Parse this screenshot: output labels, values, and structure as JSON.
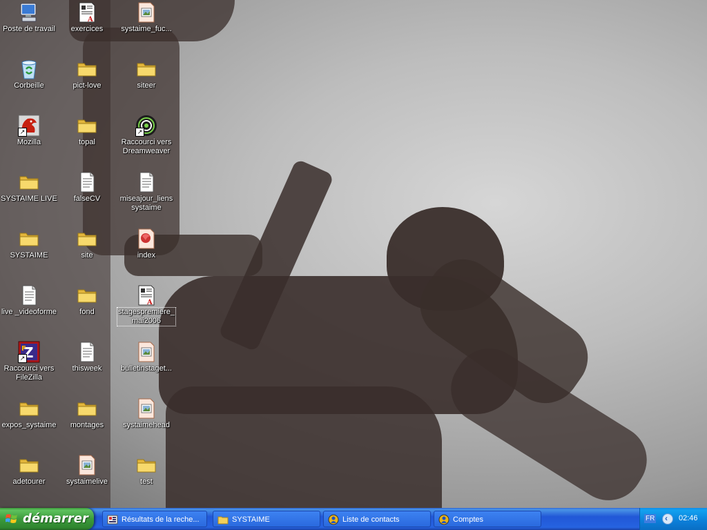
{
  "desktop": {
    "icons": [
      {
        "label": "Poste de travail",
        "icon": "computer-icon",
        "col": 0,
        "row": 0
      },
      {
        "label": "exercices",
        "icon": "document-icon",
        "col": 1,
        "row": 0
      },
      {
        "label": "systaime_fuc...",
        "icon": "image-file-icon",
        "col": 2,
        "row": 0
      },
      {
        "label": "Corbeille",
        "icon": "recycle-bin-icon",
        "col": 0,
        "row": 1
      },
      {
        "label": "pict-love",
        "icon": "folder-icon",
        "col": 1,
        "row": 1
      },
      {
        "label": "siteer",
        "icon": "folder-icon",
        "col": 2,
        "row": 1
      },
      {
        "label": "Mozilla",
        "icon": "mozilla-icon",
        "col": 0,
        "row": 2,
        "shortcut": true
      },
      {
        "label": "topal",
        "icon": "folder-icon",
        "col": 1,
        "row": 2
      },
      {
        "label": "Raccourci vers Dreamweaver",
        "icon": "dreamweaver-icon",
        "col": 2,
        "row": 2,
        "shortcut": true
      },
      {
        "label": "SYSTAIME LIVE",
        "icon": "folder-icon",
        "col": 0,
        "row": 3
      },
      {
        "label": "falseCV",
        "icon": "text-file-icon",
        "col": 1,
        "row": 3
      },
      {
        "label": "miseajour_liens systaime",
        "icon": "text-file-icon",
        "col": 2,
        "row": 3
      },
      {
        "label": "SYSTAIME",
        "icon": "folder-icon",
        "col": 0,
        "row": 4
      },
      {
        "label": "site",
        "icon": "folder-icon",
        "col": 1,
        "row": 4
      },
      {
        "label": "index",
        "icon": "html-file-icon",
        "col": 2,
        "row": 4
      },
      {
        "label": "live _videoforme",
        "icon": "text-file-icon",
        "col": 0,
        "row": 5
      },
      {
        "label": "fond",
        "icon": "folder-icon",
        "col": 1,
        "row": 5
      },
      {
        "label": "stagespremiere_ mai2006",
        "icon": "document-icon",
        "col": 2,
        "row": 5,
        "selected": true
      },
      {
        "label": "Raccourci vers FileZilla",
        "icon": "filezilla-icon",
        "col": 0,
        "row": 6,
        "shortcut": true
      },
      {
        "label": "thisweek",
        "icon": "text-file-icon",
        "col": 1,
        "row": 6
      },
      {
        "label": "bulletinstaget...",
        "icon": "image-file-icon",
        "col": 2,
        "row": 6
      },
      {
        "label": "expos_systaime",
        "icon": "folder-icon",
        "col": 0,
        "row": 7
      },
      {
        "label": "montages",
        "icon": "folder-icon",
        "col": 1,
        "row": 7
      },
      {
        "label": "systaimehead",
        "icon": "image-file-icon",
        "col": 2,
        "row": 7
      },
      {
        "label": "adetourer",
        "icon": "folder-icon",
        "col": 0,
        "row": 8
      },
      {
        "label": "systaimelive",
        "icon": "image-file-icon",
        "col": 1,
        "row": 8
      },
      {
        "label": "test",
        "icon": "folder-icon",
        "col": 2,
        "row": 8
      }
    ]
  },
  "taskbar": {
    "start_label": "démarrer",
    "tasks": [
      {
        "label": "Résultats de la reche...",
        "icon": "search-results-icon"
      },
      {
        "label": "SYSTAIME",
        "icon": "folder-icon"
      },
      {
        "label": "Liste de contacts",
        "icon": "messenger-icon"
      },
      {
        "label": "Comptes",
        "icon": "messenger-icon"
      }
    ],
    "tray": {
      "language": "FR",
      "clock": "02:46"
    }
  },
  "colors": {
    "taskbar_blue": "#2157d7",
    "start_green": "#3c9a3c",
    "tray_blue": "#0c7fd8",
    "folder_yellow": "#f2cf5b"
  }
}
